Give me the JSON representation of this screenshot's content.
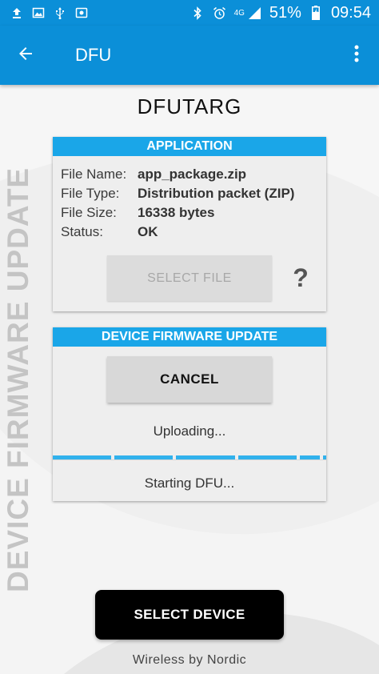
{
  "status_bar": {
    "battery_percent": "51%",
    "time": "09:54",
    "network": "4G",
    "icons": [
      "upload-icon",
      "image-icon",
      "usb-icon",
      "screencast-icon",
      "bluetooth-icon",
      "alarm-icon",
      "signal-icon",
      "battery-charging-icon"
    ]
  },
  "app_bar": {
    "title": "DFU",
    "back_icon": "arrow-back-icon",
    "menu_icon": "more-vert-icon"
  },
  "vertical_title": "DEVICE FIRMWARE UPDATE",
  "device_name": "DFUTARG",
  "application": {
    "header": "APPLICATION",
    "rows": [
      {
        "label": "File Name:",
        "value": "app_package.zip"
      },
      {
        "label": "File Type:",
        "value": "Distribution packet (ZIP)"
      },
      {
        "label": "File Size:",
        "value": "16338 bytes"
      },
      {
        "label": "Status:",
        "value": "OK"
      }
    ],
    "select_file_label": "SELECT FILE",
    "help_label": "?"
  },
  "dfu": {
    "header": "DEVICE FIRMWARE UPDATE",
    "cancel_label": "CANCEL",
    "uploading_text": "Uploading...",
    "status_text": "Starting DFU..."
  },
  "select_device_label": "SELECT DEVICE",
  "footer": "Wireless by Nordic",
  "colors": {
    "primary": "#0b8fd8",
    "panel_header": "#1aa6e8",
    "progress": "#31b1ec"
  }
}
